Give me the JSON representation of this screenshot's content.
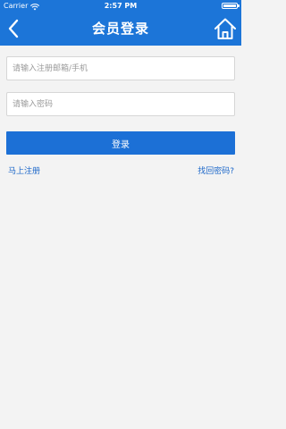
{
  "status_bar": {
    "carrier": "Carrier",
    "time": "2:57 PM",
    "wifi_icon": "wifi-icon",
    "battery_icon": "battery-icon"
  },
  "nav_bar": {
    "title": "会员登录",
    "back_icon": "chevron-left-icon",
    "home_icon": "home-icon",
    "background_color": "#1c75d8"
  },
  "form": {
    "account": {
      "placeholder": "请输入注册邮箱/手机",
      "value": ""
    },
    "password": {
      "placeholder": "请输入密码",
      "value": ""
    },
    "login_label": "登录",
    "register_label": "马上注册",
    "forgot_label": "找回密码?"
  },
  "colors": {
    "accent": "#1c70d6",
    "link": "#1c67c9",
    "background": "#f3f3f3"
  }
}
